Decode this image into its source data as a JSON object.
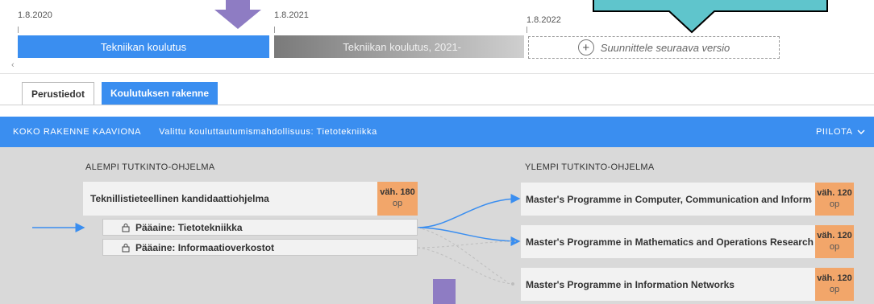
{
  "timeline": {
    "dates": [
      "1.8.2020",
      "1.8.2021",
      "1.8.2022"
    ],
    "versions": [
      {
        "label": "Tekniikan koulutus",
        "state": "active"
      },
      {
        "label": "Tekniikan koulutus, 2021-",
        "state": "future"
      }
    ],
    "plan_label": "Suunnittele seuraava versio",
    "scroll_glyph": "‹"
  },
  "tabs": [
    {
      "label": "Perustiedot",
      "active": false
    },
    {
      "label": "Koulutuksen rakenne",
      "active": true
    }
  ],
  "structure_bar": {
    "title": "KOKO RAKENNE KAAVIONA",
    "selected": "Valittu kouluttautumismahdollisuus: Tietotekniikka",
    "hide_label": "PIILOTA",
    "hide_icon": "chevron-down-icon"
  },
  "lower": {
    "heading": "ALEMPI TUTKINTO-OHJELMA",
    "programme": {
      "name": "Teknillistieteellinen kandidaattiohjelma",
      "credits": "väh. 180",
      "unit": "op"
    },
    "majors": [
      {
        "label": "Pääaine: Tietotekniikka"
      },
      {
        "label": "Pääaine: Informaatioverkostot"
      }
    ]
  },
  "upper": {
    "heading": "YLEMPI TUTKINTO-OHJELMA",
    "programmes": [
      {
        "name": "Master's Programme in Computer, Communication and Information Sciences",
        "credits": "väh. 120",
        "unit": "op",
        "highlighted": true
      },
      {
        "name": "Master's Programme in Mathematics and Operations Research",
        "credits": "väh. 120",
        "unit": "op",
        "highlighted": true
      },
      {
        "name": "Master's Programme in Information Networks",
        "credits": "väh. 120",
        "unit": "op",
        "highlighted": false
      }
    ]
  },
  "colors": {
    "accent": "#3a8ef0",
    "badge": "#f2a66a",
    "annotation_purple": "#8e7cc3",
    "annotation_teal": "#5fc5cc"
  }
}
